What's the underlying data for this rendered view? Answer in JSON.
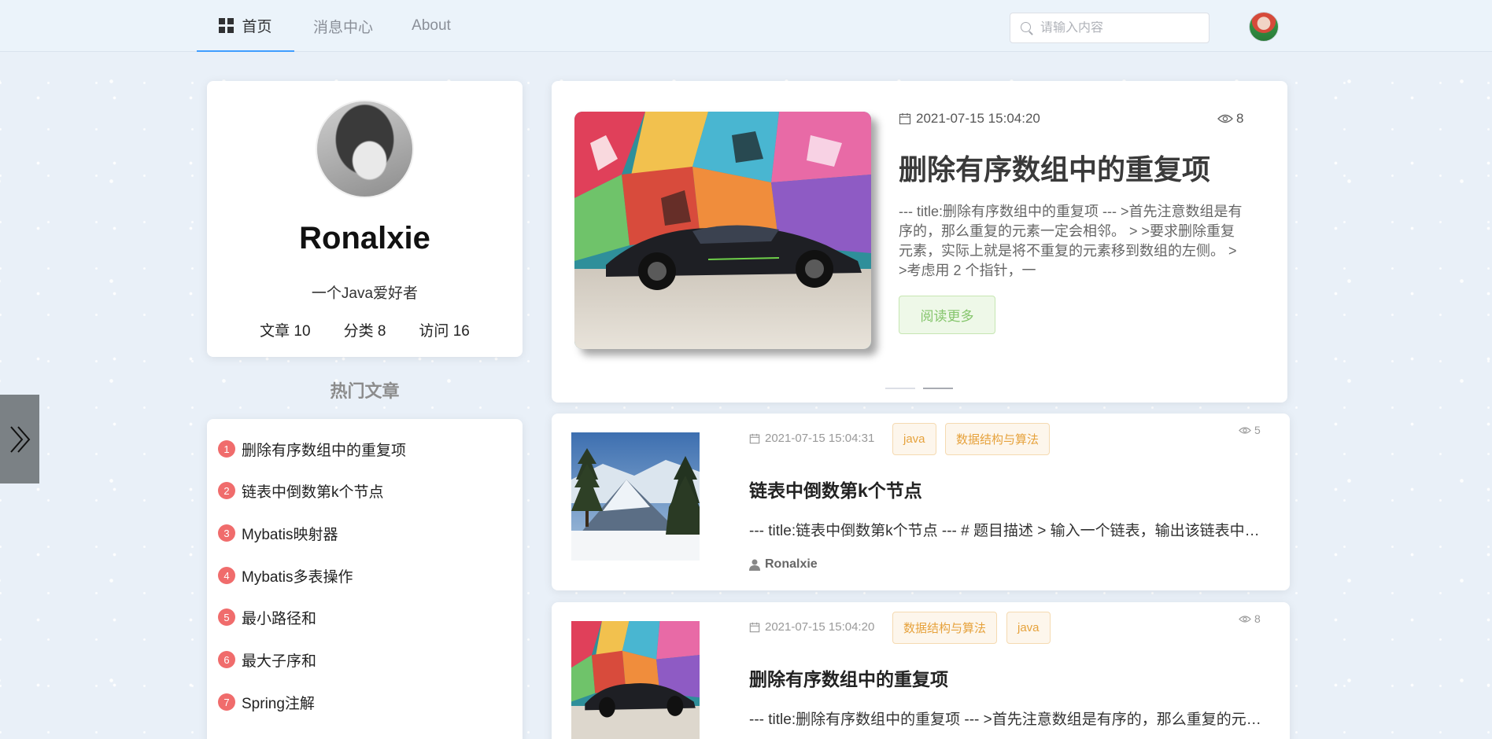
{
  "nav": {
    "tabs": [
      {
        "label": "首页",
        "active": true
      },
      {
        "label": "消息中心",
        "active": false
      },
      {
        "label": "About",
        "active": false
      }
    ]
  },
  "search": {
    "placeholder": "请输入内容",
    "value": ""
  },
  "profile": {
    "name": "Ronalxie",
    "motto": "一个Java爱好者",
    "stats": {
      "articles": "文章 10",
      "categories": "分类 8",
      "visits": "访问 16"
    }
  },
  "hot": {
    "title": "热门文章",
    "items": [
      {
        "rank": "1",
        "title": "删除有序数组中的重复项"
      },
      {
        "rank": "2",
        "title": "链表中倒数第k个节点"
      },
      {
        "rank": "3",
        "title": "Mybatis映射器"
      },
      {
        "rank": "4",
        "title": "Mybatis多表操作"
      },
      {
        "rank": "5",
        "title": "最小路径和"
      },
      {
        "rank": "6",
        "title": "最大子序和"
      },
      {
        "rank": "7",
        "title": "Spring注解"
      }
    ]
  },
  "featured": {
    "date": "2021-07-15 15:04:20",
    "views": "8",
    "title": "删除有序数组中的重复项",
    "summary": "--- title:删除有序数组中的重复项 --- >首先注意数组是有序的，那么重复的元素一定会相邻。 > >要求删除重复元素，实际上就是将不重复的元素移到数组的左侧。 > >考虑用 2 个指针，一",
    "read_more": "阅读更多",
    "carousel_count": 2,
    "carousel_active": 1
  },
  "articles": [
    {
      "date": "2021-07-15 15:04:31",
      "tags": [
        "java",
        "数据结构与算法"
      ],
      "views": "5",
      "title": "链表中倒数第k个节点",
      "summary": "--- title:链表中倒数第k个节点 --- # 题目描述 > 输入一个链表，输出该链表中倒数第k个节点。",
      "author": "Ronalxie"
    },
    {
      "date": "2021-07-15 15:04:20",
      "tags": [
        "数据结构与算法",
        "java"
      ],
      "views": "8",
      "title": "删除有序数组中的重复项",
      "summary": "--- title:删除有序数组中的重复项 --- >首先注意数组是有序的，那么重复的元素一定会相邻。"
    }
  ],
  "colors": {
    "accent": "#409eff",
    "hot_badge": "#f06c6c",
    "tag_text": "#e6a23c",
    "read_more_text": "#85c56c"
  }
}
